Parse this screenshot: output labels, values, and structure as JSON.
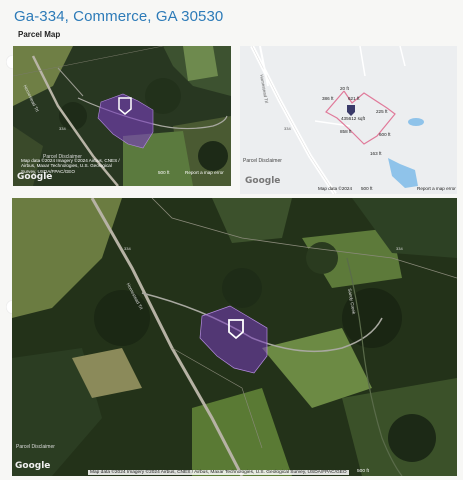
{
  "header": {
    "title": "Ga-334, Commerce, GA 30530",
    "section_label": "Parcel Map"
  },
  "map_satellite_small": {
    "attribution": "Map data ©2024 Imagery ©2024 Airbus, CNES / Airbus, Maxar Technologies, U.S. Geological Survey, USDA/FPAC/GEO",
    "scale": "500 ft",
    "report_link": "Report a map error",
    "disclaimer": "Parcel Disclaimer",
    "logo": "Google",
    "road_label": "Homestead Trl",
    "route_label": "334"
  },
  "map_street_small": {
    "measurements": {
      "north": "20 ft",
      "west": "386 ft",
      "northeast": "621 ft",
      "east_top": "225 ft",
      "area": "435612 sqft",
      "east": "600 ft",
      "south": "858 ft",
      "southeast": "163 ft"
    },
    "road_label": "Homestead Trl",
    "route_label": "334",
    "disclaimer": "Parcel Disclaimer",
    "logo": "Google",
    "attribution": "Map data ©2024",
    "scale": "500 ft",
    "report_link": "Report a map error"
  },
  "map_satellite_large": {
    "attribution": "Map data ©2024 Imagery ©2024 Airbus, CNES / Airbus, Maxar Technologies, U.S. Geological Survey, USDA/FPAC/GEO",
    "scale": "500 ft",
    "disclaimer": "Parcel Disclaimer",
    "logo": "Google",
    "road_label": "Homestead Trl",
    "route_label": "334",
    "creek_label": "Sandy Creek",
    "route_label_2": "334"
  },
  "colors": {
    "title": "#2d7bb8",
    "parcel_fill": "#7a3cc0",
    "parcel_line": "#e07a9a",
    "water": "#8fc3ea"
  }
}
